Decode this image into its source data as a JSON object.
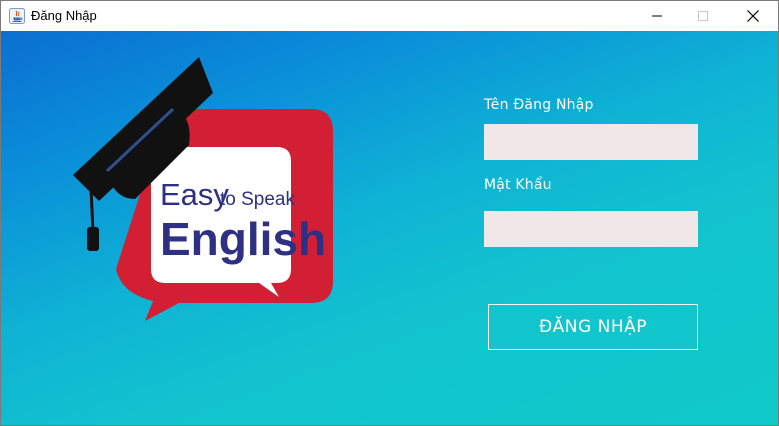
{
  "window": {
    "title": "Đăng Nhập",
    "controls": {
      "minimize": "minimize-icon",
      "maximize": "maximize-icon",
      "close": "close-icon"
    }
  },
  "logo": {
    "word_easy": "Easy",
    "word_to_speak": "to Speak",
    "word_english": "English",
    "colors": {
      "bubble": "#d21f34",
      "inner": "#ffffff",
      "text": "#2e3183",
      "cap": "#111111"
    }
  },
  "form": {
    "username_label": "Tên Đăng Nhập",
    "username_value": "",
    "password_label": "Mật Khẩu",
    "password_value": "",
    "login_label": "ĐĂNG NHẬP"
  },
  "colors": {
    "field_bg": "#f1e6e8",
    "gradient_start": "#0b6fd1",
    "gradient_end": "#0fcac8"
  }
}
